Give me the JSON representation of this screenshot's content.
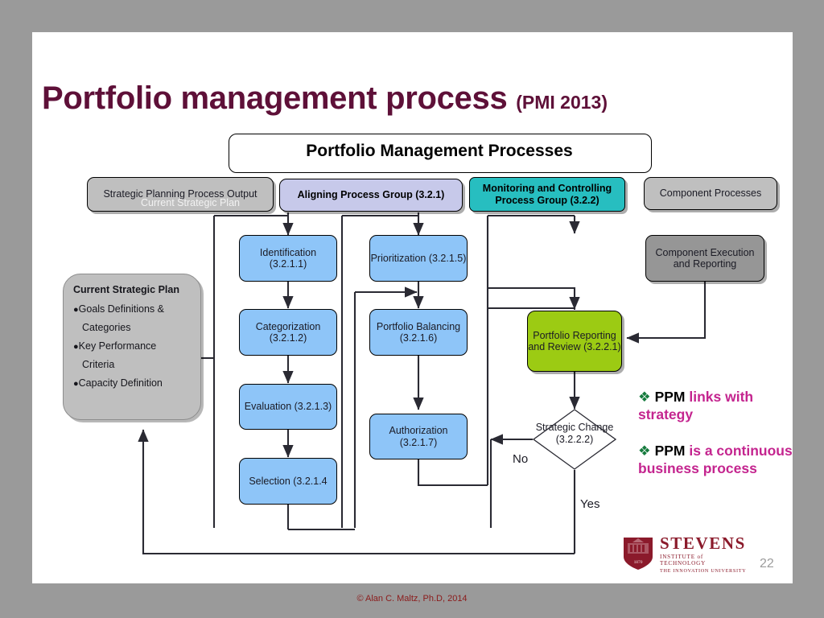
{
  "slide": {
    "title_main": "Portfolio management process",
    "title_sub": "(PMI 2013)",
    "page_number": "22",
    "footer": "© Alan C. Maltz, Ph.D, 2014"
  },
  "header_box": {
    "label": "Portfolio Management Processes"
  },
  "groups": [
    {
      "id": "strategic-planning-output",
      "label": "Strategic Planning Process Output",
      "overlay": "Current Strategic Plan",
      "color": "#bfbfbf"
    },
    {
      "id": "aligning-process-group",
      "label": "Aligning Process Group (3.2.1)",
      "color": "#c7c9ea"
    },
    {
      "id": "monitoring-controlling-process-group",
      "label": "Monitoring and Controlling Process Group (3.2.2)",
      "color": "#27bec0"
    },
    {
      "id": "component-processes",
      "label": "Component Processes",
      "color": "#bfbfbf"
    }
  ],
  "sidebar": {
    "title": "Current Strategic Plan",
    "items": [
      "Goals Definitions &",
      "Categories",
      "Key Performance",
      "Criteria",
      "Capacity Definition"
    ],
    "bulleted": [
      true,
      false,
      true,
      false,
      true
    ]
  },
  "nodes": {
    "identification": "Identification (3.2.1.1)",
    "categorization": "Categorization (3.2.1.2)",
    "evaluation": "Evaluation (3.2.1.3)",
    "selection": "Selection (3.2.1.4",
    "prioritization": "Prioritization (3.2.1.5)",
    "portfolio_balancing": "Portfolio Balancing (3.2.1.6)",
    "authorization": "Authorization (3.2.1.7)",
    "component_execution": "Component Execution and Reporting",
    "portfolio_reporting": "Portfolio Reporting and Review (3.2.2.1)",
    "strategic_change": "Strategic Change (3.2.2.2)"
  },
  "edge_labels": {
    "no": "No",
    "yes": "Yes"
  },
  "bullets": [
    {
      "mark": "❖",
      "strong": "PPM",
      "rest": " links with strategy"
    },
    {
      "mark": "❖",
      "strong": "PPM",
      "rest": " is a continuous business process"
    }
  ],
  "logo": {
    "name": "STEVENS",
    "line2": "INSTITUTE of TECHNOLOGY",
    "line3": "THE INNOVATION UNIVERSITY",
    "shield_year": "1870"
  },
  "colors": {
    "title": "#5e1038",
    "process": "#8ec5f8",
    "teal": "#27bec0",
    "lavender": "#c7c9ea",
    "grey": "#bfbfbf",
    "dark_grey": "#969696",
    "green": "#9ccb13",
    "accent_pink": "#c4258f",
    "logo_red": "#8b1a2b"
  }
}
